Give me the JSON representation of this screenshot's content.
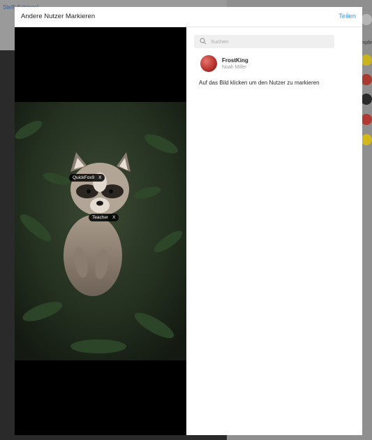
{
  "background": {
    "top_link": "Steffi Schlegel",
    "right_label": "Empfe"
  },
  "modal": {
    "title": "Andere Nutzer Markieren",
    "share_label": "Teilen"
  },
  "image": {
    "tags": [
      {
        "name": "QuickFox9",
        "remove": "X"
      },
      {
        "name": "Teacher",
        "remove": "X"
      }
    ]
  },
  "search": {
    "placeholder": "Suchen",
    "icon": "search-icon"
  },
  "results": [
    {
      "username": "FrostKing",
      "fullname": "Noah Miller"
    }
  ],
  "hint": "Auf das Bild klicken um den Nutzer zu markieren",
  "colors": {
    "accent": "#3897f0",
    "overlay": "#8a8a8a",
    "tag_bg": "#000000"
  }
}
